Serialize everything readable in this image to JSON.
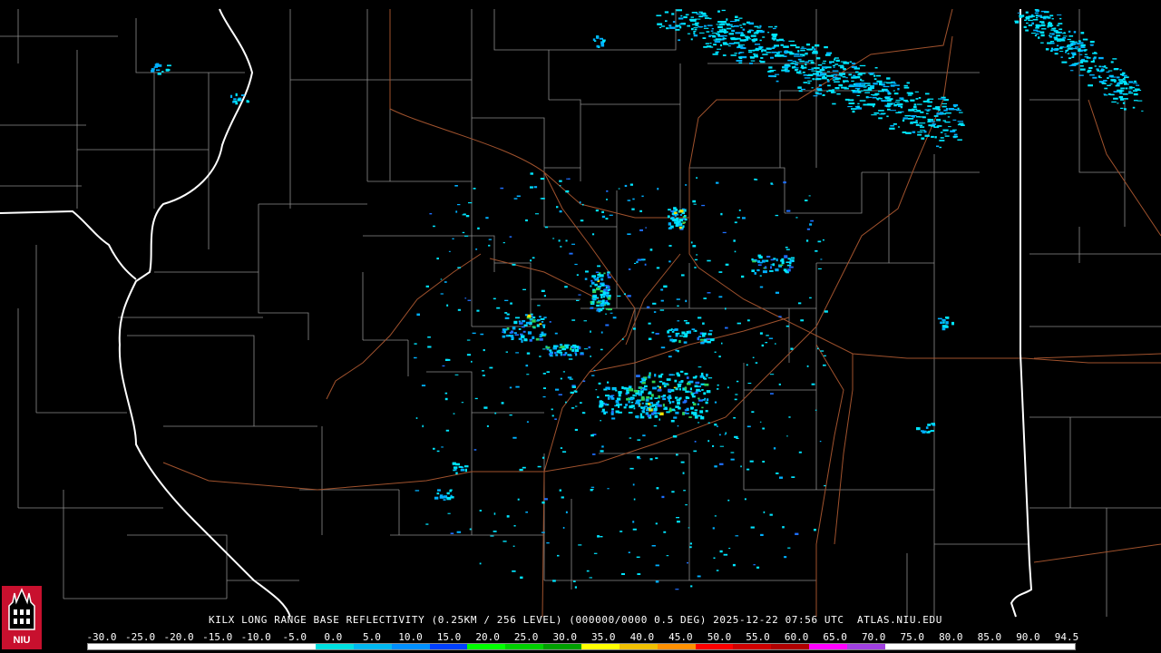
{
  "title": "KILX LONG RANGE BASE REFLECTIVITY (0.25KM / 256 LEVEL) (000000/0000 0.5 DEG) 2025-12-22 07:56 UTC  ATLAS.NIU.EDU",
  "scale": {
    "labels": [
      "-30.0",
      "-25.0",
      "-20.0",
      "-15.0",
      "-10.0",
      "-5.0",
      "0.0",
      "5.0",
      "10.0",
      "15.0",
      "20.0",
      "25.0",
      "30.0",
      "35.0",
      "40.0",
      "45.0",
      "50.0",
      "55.0",
      "60.0",
      "65.0",
      "70.0",
      "75.0",
      "80.0",
      "85.0",
      "90.0",
      "94.5"
    ],
    "colors": [
      "#ffffff",
      "#ffffff",
      "#ffffff",
      "#ffffff",
      "#ffffff",
      "#ffffff",
      "#00e0e0",
      "#00b8f0",
      "#0090ff",
      "#0040ff",
      "#00ff00",
      "#00d000",
      "#00a000",
      "#ffff00",
      "#f0c000",
      "#ff9000",
      "#ff0000",
      "#d00000",
      "#b00000",
      "#ff00ff",
      "#a040e0",
      "#ffffff",
      "#ffffff",
      "#ffffff",
      "#ffffff",
      "#ffffff"
    ]
  },
  "logo": {
    "text": "NIU",
    "icon": "niu-tower-icon",
    "color": "#c8102e"
  },
  "map": {
    "state_border_color": "#ffffff",
    "county_border_color": "#8c8c8c",
    "highway_color": "#a0522d",
    "echo_colors": [
      "#00e5ff",
      "#00b0ff",
      "#1f6fff",
      "#2fd05a",
      "#f0e000"
    ]
  }
}
